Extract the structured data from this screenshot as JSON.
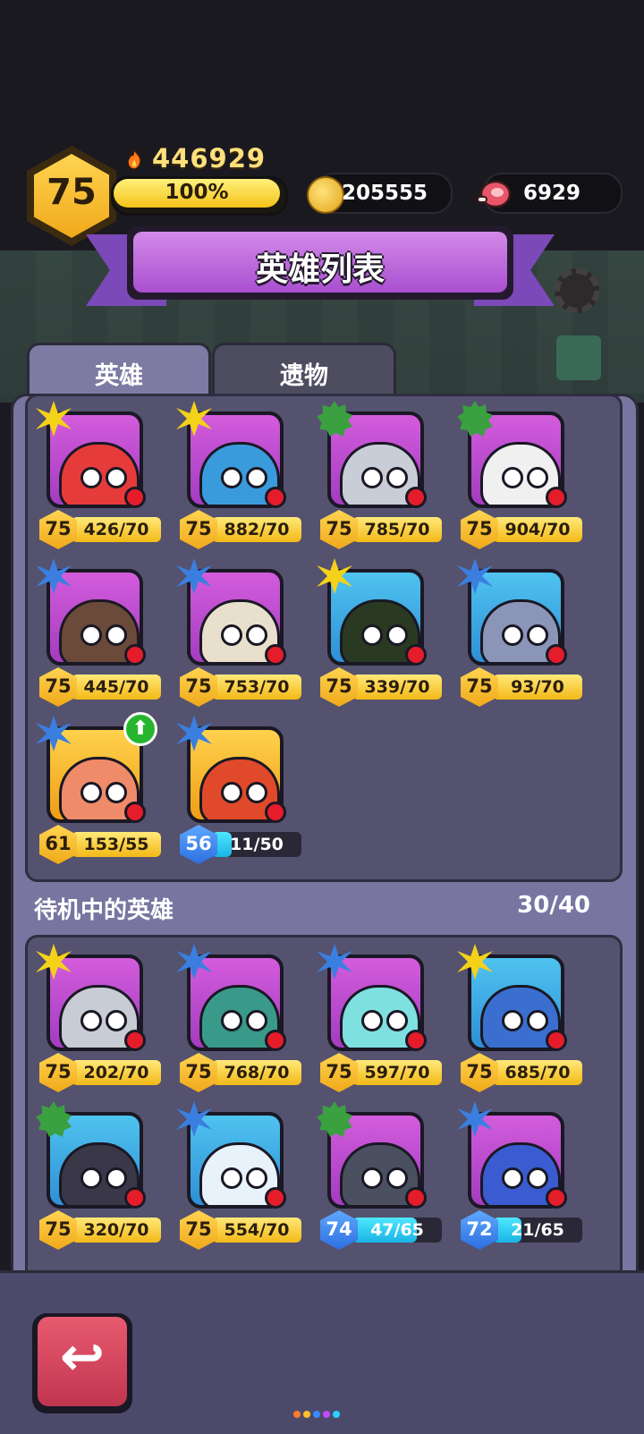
{
  "header": {
    "level": "75",
    "power": "446929",
    "xp_percent": "100%",
    "xp_fraction": 1.0,
    "gold": "205555",
    "meat": "6929"
  },
  "title": "英雄列表",
  "tabs": [
    {
      "label": "英雄",
      "active": true
    },
    {
      "label": "遗物",
      "active": false
    }
  ],
  "standby_section": {
    "title": "待机中的英雄",
    "count": "30/40"
  },
  "active_heroes": [
    {
      "name": "hero-green-hood",
      "rarity": "gold",
      "level": "75",
      "progress": "426/70",
      "fill": 1.0,
      "bar": "gold",
      "bg": "purple",
      "body": "#e63b3b"
    },
    {
      "name": "hero-blue-miner",
      "rarity": "gold",
      "level": "75",
      "progress": "882/70",
      "fill": 1.0,
      "bar": "gold",
      "bg": "purple",
      "body": "#3a9bdc"
    },
    {
      "name": "hero-robot",
      "rarity": "green",
      "level": "75",
      "progress": "785/70",
      "fill": 1.0,
      "bar": "gold",
      "bg": "purple",
      "body": "#c9cdd8"
    },
    {
      "name": "hero-leaf-bot",
      "rarity": "green",
      "level": "75",
      "progress": "904/70",
      "fill": 1.0,
      "bar": "gold",
      "bg": "purple",
      "body": "#f0f0f0"
    },
    {
      "name": "hero-treant",
      "rarity": "blue",
      "level": "75",
      "progress": "445/70",
      "fill": 1.0,
      "bar": "gold",
      "bg": "purple",
      "body": "#6b4a3a"
    },
    {
      "name": "hero-mummy",
      "rarity": "blue",
      "level": "75",
      "progress": "753/70",
      "fill": 1.0,
      "bar": "gold",
      "bg": "purple",
      "body": "#e8e0cc"
    },
    {
      "name": "hero-ninja-cat",
      "rarity": "gold",
      "level": "75",
      "progress": "339/70",
      "fill": 1.0,
      "bar": "gold",
      "bg": "blue",
      "body": "#2a3a22"
    },
    {
      "name": "hero-storm-cloud",
      "rarity": "blue",
      "level": "75",
      "progress": "93/70",
      "fill": 1.0,
      "bar": "gold",
      "bg": "blue",
      "body": "#8a95b8"
    },
    {
      "name": "hero-bird",
      "rarity": "blue",
      "level": "61",
      "progress": "153/55",
      "fill": 1.0,
      "bar": "gold",
      "bg": "gold",
      "body": "#f08b6a",
      "upgrade": true
    },
    {
      "name": "hero-lion-dancer",
      "rarity": "blue",
      "level": "56",
      "progress": "11/50",
      "fill": 0.22,
      "bar": "blue",
      "bg": "gold",
      "body": "#e04a2a",
      "lvblue": true
    }
  ],
  "standby_heroes": [
    {
      "name": "hero-knight",
      "rarity": "gold",
      "level": "75",
      "progress": "202/70",
      "fill": 1.0,
      "bar": "gold",
      "bg": "purple",
      "body": "#c8ccd4"
    },
    {
      "name": "hero-dino",
      "rarity": "blue",
      "level": "75",
      "progress": "768/70",
      "fill": 1.0,
      "bar": "gold",
      "bg": "purple",
      "body": "#3a9a8a"
    },
    {
      "name": "hero-bunny",
      "rarity": "blue",
      "level": "75",
      "progress": "597/70",
      "fill": 1.0,
      "bar": "gold",
      "bg": "purple",
      "body": "#7fe0e0"
    },
    {
      "name": "hero-samurai",
      "rarity": "gold",
      "level": "75",
      "progress": "685/70",
      "fill": 1.0,
      "bar": "gold",
      "bg": "blue",
      "body": "#3a6fd0"
    },
    {
      "name": "hero-mech",
      "rarity": "green",
      "level": "75",
      "progress": "320/70",
      "fill": 1.0,
      "bar": "gold",
      "bg": "blue",
      "body": "#3a3848"
    },
    {
      "name": "hero-snowman",
      "rarity": "blue",
      "level": "75",
      "progress": "554/70",
      "fill": 1.0,
      "bar": "gold",
      "bg": "blue",
      "body": "#e8f2fa"
    },
    {
      "name": "hero-shark",
      "rarity": "green",
      "level": "74",
      "progress": "47/65",
      "fill": 0.72,
      "bar": "blue",
      "bg": "purple",
      "body": "#4a5060",
      "lvblue": true
    },
    {
      "name": "hero-viking",
      "rarity": "blue",
      "level": "72",
      "progress": "21/65",
      "fill": 0.32,
      "bar": "blue",
      "bg": "purple",
      "body": "#3a5cd0",
      "lvblue": true
    }
  ],
  "icons": {
    "fire": "fire-icon",
    "coin": "gold-coin-icon",
    "meat": "meat-icon",
    "gear": "gear-icon",
    "mail": "mail-icon",
    "back": "back-arrow-icon",
    "upgrade": "upgrade-arrow-icon"
  },
  "back_glyph": "↩",
  "upgrade_glyph": "⬆",
  "page_dot_colors": [
    "#ff7a2a",
    "#ffbf2a",
    "#3a8bff",
    "#c04aff",
    "#2ad0ff"
  ]
}
